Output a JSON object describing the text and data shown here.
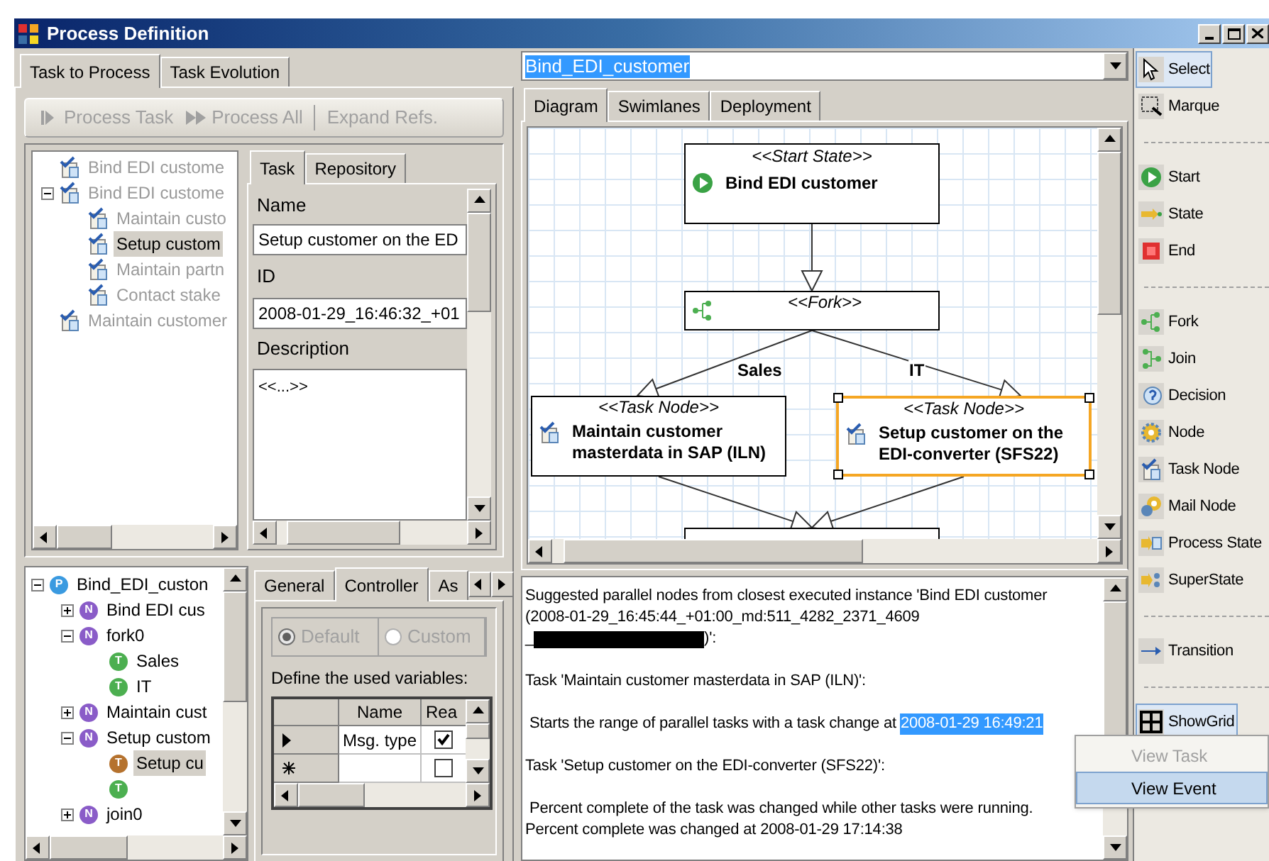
{
  "window": {
    "title": "Process Definition"
  },
  "main_tabs": [
    {
      "label": "Task to Process",
      "selected": true
    },
    {
      "label": "Task Evolution",
      "selected": false
    }
  ],
  "toolbar": [
    {
      "label": "Process Task",
      "disabled": true
    },
    {
      "label": "Process All",
      "disabled": true
    },
    {
      "label": "Expand Refs.",
      "disabled": true
    }
  ],
  "task_tree": [
    {
      "label": "Bind EDI custome",
      "disabled": true,
      "selected": false
    },
    {
      "label": "Bind EDI custome",
      "disabled": true,
      "selected": false,
      "expanded": true,
      "children": [
        {
          "label": "Maintain custo",
          "disabled": true,
          "selected": false
        },
        {
          "label": "Setup custom",
          "disabled": false,
          "selected": true
        },
        {
          "label": "Maintain partn",
          "disabled": true,
          "selected": false
        },
        {
          "label": "Contact stake",
          "disabled": true,
          "selected": false
        }
      ]
    },
    {
      "label": "Maintain customer",
      "disabled": true,
      "selected": false
    }
  ],
  "property_tabs": [
    {
      "label": "Task",
      "selected": true
    },
    {
      "label": "Repository",
      "selected": false
    }
  ],
  "properties": {
    "name_label": "Name",
    "name_value": "Setup customer on the ED",
    "id_label": "ID",
    "id_value": "2008-01-29_16:46:32_+01",
    "description_label": "Description",
    "description_value": "<<...>>"
  },
  "process_tree": [
    {
      "label": "Bind_EDI_custon",
      "badge": "P",
      "color": "#3a9ae0",
      "expanded": true,
      "selected": false,
      "children": [
        {
          "label": "Bind EDI cus",
          "badge": "N",
          "color": "#8a5cc8",
          "expanded": false,
          "selected": false
        },
        {
          "label": "fork0",
          "badge": "N",
          "color": "#8a5cc8",
          "expanded": true,
          "selected": false,
          "children": [
            {
              "label": "Sales",
              "badge": "T",
              "color": "#4caf50",
              "selected": false
            },
            {
              "label": "IT",
              "badge": "T",
              "color": "#4caf50",
              "selected": false
            }
          ]
        },
        {
          "label": "Maintain cust",
          "badge": "N",
          "color": "#8a5cc8",
          "expanded": false,
          "selected": false
        },
        {
          "label": "Setup custom",
          "badge": "N",
          "color": "#8a5cc8",
          "expanded": true,
          "selected": false,
          "children": [
            {
              "label": "Setup cu",
              "badge": "T",
              "color": "#b5722e",
              "selected": true
            },
            {
              "badge": "T",
              "color": "#4caf50"
            }
          ]
        },
        {
          "label": "join0",
          "badge": "N",
          "color": "#8a5cc8",
          "expanded": false,
          "selected": false
        }
      ]
    }
  ],
  "detail_tabs": [
    {
      "label": "General",
      "selected": false
    },
    {
      "label": "Controller",
      "selected": true
    },
    {
      "label": "As",
      "selected": false
    }
  ],
  "controller": {
    "options": [
      {
        "label": "Default",
        "selected": true,
        "disabled": true
      },
      {
        "label": "Custom",
        "selected": false,
        "disabled": true
      }
    ],
    "hint": "Define the used variables:",
    "columns": [
      "Name",
      "Rea"
    ],
    "rows": [
      {
        "kind": "current",
        "name": "Msg. type",
        "checked": true
      },
      {
        "kind": "new",
        "checked": false
      }
    ]
  },
  "process_selector": {
    "value": "Bind_EDI_customer"
  },
  "diagram_tabs": [
    {
      "label": "Diagram",
      "selected": true
    },
    {
      "label": "Swimlanes",
      "selected": false
    },
    {
      "label": "Deployment",
      "selected": false
    }
  ],
  "diagram": {
    "nodes": [
      {
        "kind": "start",
        "stereotype": "<<Start State>>",
        "label": "Bind EDI customer",
        "selected": false
      },
      {
        "kind": "fork",
        "stereotype": "<<Fork>>",
        "selected": false
      },
      {
        "kind": "task",
        "stereotype": "<<Task Node>>",
        "label": "Maintain customer masterdata in SAP (ILN)",
        "selected": false
      },
      {
        "kind": "task",
        "stereotype": "<<Task Node>>",
        "label": "Setup customer on the EDI-converter (SFS22)",
        "selected": true
      },
      {
        "kind": "join"
      }
    ],
    "transition_labels": [
      "Sales",
      "IT"
    ]
  },
  "output": {
    "paragraphs": [
      {
        "lines": [
          {
            "kind": "plain",
            "text": "Suggested parallel nodes from closest executed instance 'Bind EDI customer"
          },
          {
            "kind": "plain",
            "text": "(2008-01-29_16:45:44_+01:00_md:511_4282_2371_4609"
          },
          {
            "kind": "redacted",
            "before": "_",
            "after": ")':"
          }
        ]
      },
      {
        "lines": [
          {
            "kind": "plain",
            "text": "Task 'Maintain customer masterdata in SAP (ILN)':"
          }
        ]
      },
      {
        "lines": [
          {
            "kind": "highlighted",
            "text": " Starts the range of parallel tasks with a task change at ",
            "highlight": "2008-01-29 16:49:21"
          }
        ]
      },
      {
        "lines": [
          {
            "kind": "plain",
            "text": "Task 'Setup customer on the EDI-converter (SFS22)':"
          }
        ]
      },
      {
        "lines": [
          {
            "kind": "plain",
            "text": " Percent complete of the task was changed while other tasks were running."
          },
          {
            "kind": "plain",
            "text": "Percent complete was changed at 2008-01-29 17:14:38"
          }
        ]
      }
    ]
  },
  "toolbox": [
    {
      "kind": "tool",
      "label": "Select",
      "selected": true
    },
    {
      "kind": "tool",
      "label": "Marque",
      "selected": false
    },
    {
      "kind": "separator"
    },
    {
      "kind": "tool",
      "label": "Start",
      "selected": false
    },
    {
      "kind": "tool",
      "label": "State",
      "selected": false
    },
    {
      "kind": "tool",
      "label": "End",
      "selected": false
    },
    {
      "kind": "separator"
    },
    {
      "kind": "tool",
      "label": "Fork",
      "selected": false
    },
    {
      "kind": "tool",
      "label": "Join",
      "selected": false
    },
    {
      "kind": "tool",
      "label": "Decision",
      "selected": false
    },
    {
      "kind": "tool",
      "label": "Node",
      "selected": false
    },
    {
      "kind": "tool",
      "label": "Task Node",
      "selected": false
    },
    {
      "kind": "tool",
      "label": "Mail Node",
      "selected": false
    },
    {
      "kind": "tool",
      "label": "Process State",
      "selected": false
    },
    {
      "kind": "tool",
      "label": "SuperState",
      "selected": false
    },
    {
      "kind": "separator"
    },
    {
      "kind": "tool",
      "label": "Transition",
      "selected": false
    },
    {
      "kind": "separator"
    },
    {
      "kind": "tool",
      "label": "ShowGrid",
      "selected": true
    }
  ],
  "context_menu": [
    {
      "label": "View Task",
      "disabled": true,
      "selected": false
    },
    {
      "label": "View Event",
      "disabled": false,
      "selected": true
    }
  ]
}
